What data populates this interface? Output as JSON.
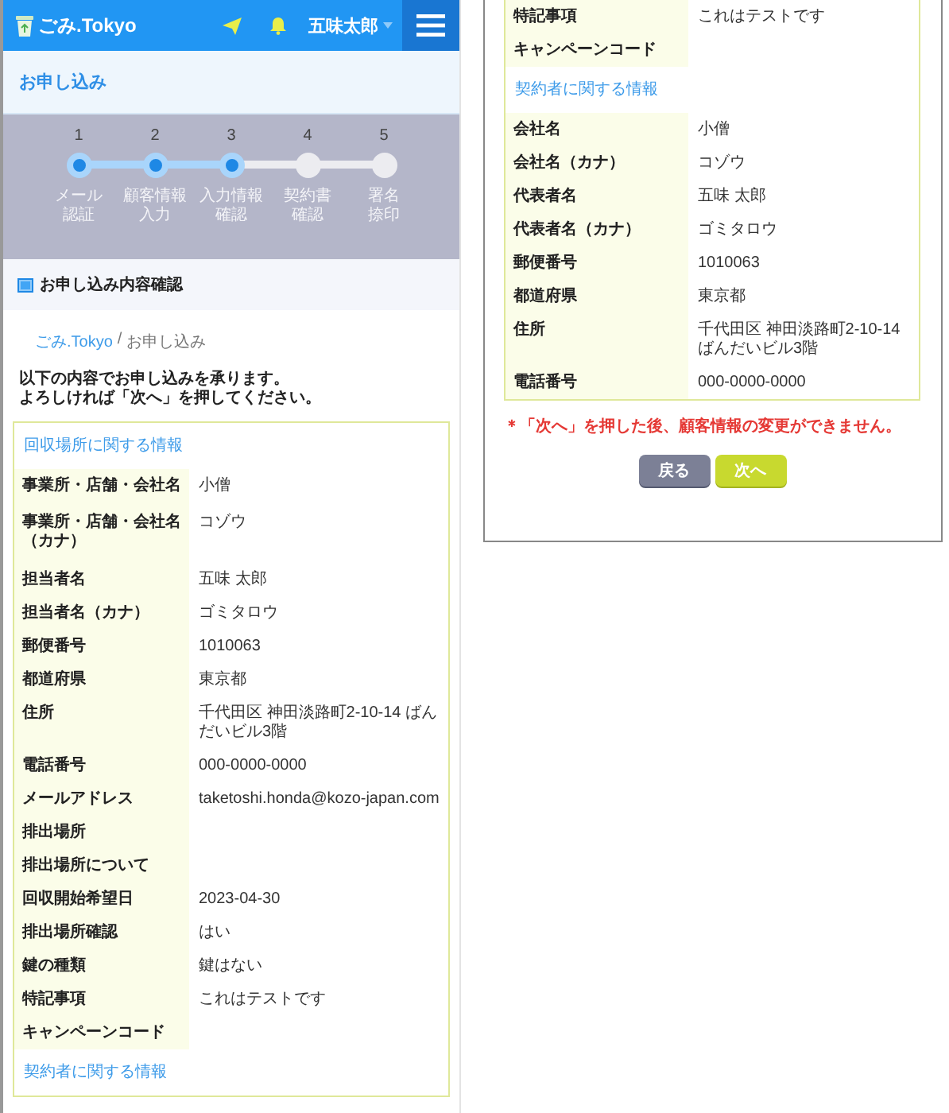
{
  "header": {
    "logo": "ごみ.Tokyo",
    "user": "五味太郎"
  },
  "page_title": "お申し込み",
  "steps": [
    {
      "number": "1",
      "label": [
        "メール",
        "認証"
      ],
      "completed": true
    },
    {
      "number": "2",
      "label": [
        "顧客情報",
        "入力"
      ],
      "completed": true
    },
    {
      "number": "3",
      "label": [
        "入力情報",
        "確認"
      ],
      "completed": true
    },
    {
      "number": "4",
      "label": [
        "契約書",
        "確認"
      ],
      "completed": false
    },
    {
      "number": "5",
      "label": [
        "署名",
        "捺印"
      ],
      "completed": false
    }
  ],
  "section_title": "お申し込み内容確認",
  "breadcrumb": {
    "link": "ごみ.Tokyo",
    "separator": "/",
    "current": "お申し込み"
  },
  "intro": [
    "以下の内容でお申し込みを承ります。",
    "よろしければ「次へ」を押してください。"
  ],
  "left_card": [
    {
      "kind": "heading",
      "text": "回収場所に関する情報"
    },
    {
      "kind": "row",
      "label": "事業所・店舗・会社名",
      "value": "小僧"
    },
    {
      "kind": "row",
      "label": "事業所・店舗・会社名（カナ）",
      "value": "コゾウ"
    },
    {
      "kind": "row",
      "label": "担当者名",
      "value": "五味 太郎"
    },
    {
      "kind": "row",
      "label": "担当者名（カナ）",
      "value": "ゴミタロウ"
    },
    {
      "kind": "row",
      "label": "郵便番号",
      "value": "1010063"
    },
    {
      "kind": "row",
      "label": "都道府県",
      "value": "東京都"
    },
    {
      "kind": "row",
      "label": "住所",
      "value": "千代田区 神田淡路町2-10-14 ばんだいビル3階"
    },
    {
      "kind": "row",
      "label": "電話番号",
      "value": "000-0000-0000"
    },
    {
      "kind": "row",
      "label": "メールアドレス",
      "value": "taketoshi.honda@kozo-japan.com"
    },
    {
      "kind": "row",
      "label": "排出場所"
    },
    {
      "kind": "row",
      "label": "排出場所について"
    },
    {
      "kind": "row",
      "label": "回収開始希望日",
      "value": "2023-04-30"
    },
    {
      "kind": "row",
      "label": "排出場所確認",
      "value": "はい"
    },
    {
      "kind": "row",
      "label": "鍵の種類",
      "value": "鍵はない"
    },
    {
      "kind": "row",
      "label": "特記事項",
      "value": "これはテストです"
    },
    {
      "kind": "row",
      "label": "キャンペーンコード"
    },
    {
      "kind": "heading",
      "text": "契約者に関する情報"
    }
  ],
  "right_card": [
    {
      "kind": "row",
      "label": "特記事項",
      "value": "これはテストです"
    },
    {
      "kind": "row",
      "label": "キャンペーンコード"
    },
    {
      "kind": "heading",
      "text": "契約者に関する情報"
    },
    {
      "kind": "row",
      "label": "会社名",
      "value": "小僧"
    },
    {
      "kind": "row",
      "label": "会社名（カナ）",
      "value": "コゾウ"
    },
    {
      "kind": "row",
      "label": "代表者名",
      "value": "五味 太郎"
    },
    {
      "kind": "row",
      "label": "代表者名（カナ）",
      "value": "ゴミタロウ"
    },
    {
      "kind": "row",
      "label": "郵便番号",
      "value": "1010063"
    },
    {
      "kind": "row",
      "label": "都道府県",
      "value": "東京都"
    },
    {
      "kind": "row",
      "label": "住所",
      "value": "千代田区 神田淡路町2-10-14 ばんだいビル3階"
    },
    {
      "kind": "row",
      "label": "電話番号",
      "value": "000-0000-0000"
    }
  ],
  "note": "＊「次へ」を押した後、顧客情報の変更ができません。",
  "buttons": [
    {
      "label": "戻る",
      "kind": "back"
    },
    {
      "label": "次へ",
      "kind": "next"
    }
  ]
}
